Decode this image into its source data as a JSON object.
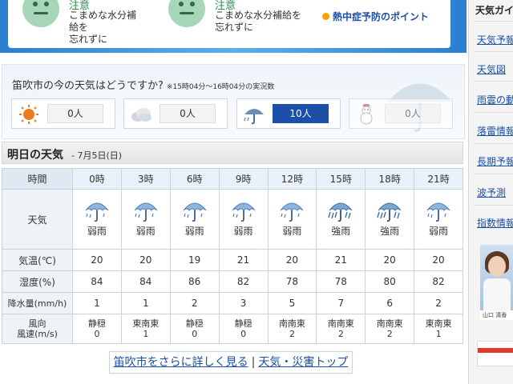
{
  "alerts": [
    {
      "title": "注意",
      "line1": "こまめな水分補給を",
      "line2": "忘れずに"
    },
    {
      "title": "注意",
      "line1": "こまめな水分補給を",
      "line2": "忘れずに"
    }
  ],
  "tips_link": "熱中症予防のポイント",
  "poll": {
    "question": "笛吹市の今の天気はどうですか?",
    "note": "※15時04分～16時04分の実況数",
    "options": [
      {
        "icon": "sun-icon",
        "count": "0人"
      },
      {
        "icon": "cloud-icon",
        "count": "0人"
      },
      {
        "icon": "rain-umbrella-icon",
        "count": "10人",
        "selected": true
      },
      {
        "icon": "snowman-icon",
        "count": "0人"
      }
    ]
  },
  "tomorrow": {
    "title": "明日の天気",
    "date": "- 7月5日(日)"
  },
  "table": {
    "labels": {
      "time": "時間",
      "weather": "天気",
      "temp": "気温(℃)",
      "humidity": "湿度(%)",
      "precip": "降水量(mm/h)",
      "wind_dir": "風向",
      "wind_speed": "風速(m/s)"
    },
    "hours": [
      "0時",
      "3時",
      "6時",
      "9時",
      "12時",
      "15時",
      "18時",
      "21時"
    ],
    "weather": [
      "弱雨",
      "弱雨",
      "弱雨",
      "弱雨",
      "弱雨",
      "強雨",
      "強雨",
      "弱雨"
    ],
    "weather_icons": [
      "rain-icon",
      "rain-icon",
      "rain-icon",
      "rain-icon",
      "rain-icon",
      "heavy-rain-icon",
      "heavy-rain-icon",
      "rain-icon"
    ],
    "temp": [
      "20",
      "20",
      "19",
      "21",
      "20",
      "21",
      "20",
      "20"
    ],
    "humidity": [
      "84",
      "84",
      "86",
      "82",
      "78",
      "78",
      "80",
      "82"
    ],
    "precip": [
      "1",
      "1",
      "2",
      "3",
      "5",
      "7",
      "6",
      "2"
    ],
    "wind_dir": [
      "静穏",
      "東南東",
      "静穏",
      "静穏",
      "南南東",
      "南南東",
      "南南東",
      "東南東"
    ],
    "wind_speed": [
      "0",
      "1",
      "0",
      "0",
      "2",
      "2",
      "2",
      "1"
    ]
  },
  "footer": {
    "more_link": "笛吹市をさらに詳しく見る",
    "separator": "|",
    "top_link": "天気・災害トップ"
  },
  "sidebar": {
    "heading": "天気ガイ",
    "items": [
      "天気予報",
      "天気図",
      "雨雲の動",
      "落雷情報",
      "長期予報",
      "波予測",
      "指数情報"
    ],
    "photo_caption": "山口 清香"
  },
  "colors": {
    "accent_blue": "#1c4fa8",
    "link": "#1a4fa3",
    "alert_green": "#2e8a4f"
  }
}
